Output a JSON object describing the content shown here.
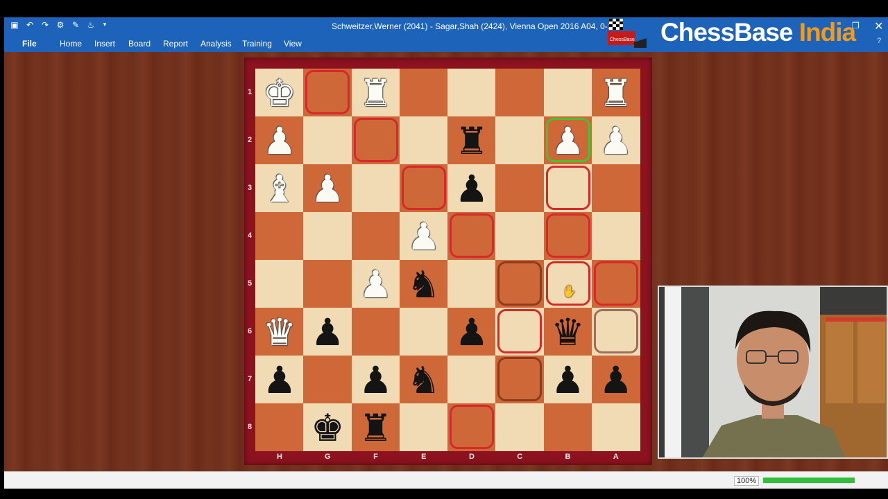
{
  "window": {
    "title": "Schweitzer,Werner (2041) - Sagar,Shah (2424), Vienna Open 2016  A04, 0-1",
    "close_glyph": "✕",
    "restore_glyph": "❐",
    "help_glyph": "?"
  },
  "quick_access": [
    "new-icon",
    "undo-icon",
    "redo-icon",
    "settings-icon",
    "tool-icon",
    "hint-icon",
    "dropdown-icon"
  ],
  "menu": {
    "file": "File",
    "items": [
      "Home",
      "Insert",
      "Board",
      "Report",
      "Analysis",
      "Training",
      "View"
    ]
  },
  "logo": {
    "small_text": "ChessBase",
    "brand_main": "ChessBase ",
    "brand_accent": "India"
  },
  "board": {
    "ranks": [
      "1",
      "2",
      "3",
      "4",
      "5",
      "6",
      "7",
      "8"
    ],
    "files": [
      "H",
      "G",
      "F",
      "E",
      "D",
      "C",
      "B",
      "A"
    ],
    "pieces": [
      [
        "♚",
        "",
        "♜",
        "",
        "",
        "",
        "",
        "♜"
      ],
      [
        "♟",
        "",
        "",
        "",
        "♜",
        "",
        "♟",
        "♟"
      ],
      [
        "♝",
        "♟",
        "",
        "",
        "♟",
        "",
        "",
        ""
      ],
      [
        "",
        "",
        "",
        "♟",
        "",
        "",
        "",
        ""
      ],
      [
        "",
        "",
        "♟",
        "♞",
        "",
        "",
        "",
        ""
      ],
      [
        "♛",
        "♟",
        "",
        "",
        "♟",
        "",
        "♛",
        ""
      ],
      [
        "♟",
        "",
        "♟",
        "♞",
        "",
        "",
        "♟",
        "♟"
      ],
      [
        "",
        "♚",
        "♜",
        "",
        "",
        "",
        "",
        ""
      ]
    ],
    "colors": [
      [
        "w",
        "",
        "w",
        "",
        "",
        "",
        "",
        "w"
      ],
      [
        "w",
        "",
        "",
        "",
        "b",
        "",
        "w",
        "w"
      ],
      [
        "w",
        "w",
        "",
        "",
        "b",
        "",
        "",
        ""
      ],
      [
        "",
        "",
        "",
        "w",
        "",
        "",
        "",
        ""
      ],
      [
        "",
        "",
        "w",
        "b",
        "",
        "",
        "",
        ""
      ],
      [
        "w",
        "b",
        "",
        "",
        "b",
        "",
        "b",
        ""
      ],
      [
        "b",
        "",
        "b",
        "b",
        "",
        "",
        "b",
        "b"
      ],
      [
        "",
        "b",
        "b",
        "",
        "",
        "",
        "",
        ""
      ]
    ],
    "highlights": [
      {
        "rank": 0,
        "file": 1,
        "color": "red"
      },
      {
        "rank": 1,
        "file": 2,
        "color": "red"
      },
      {
        "rank": 1,
        "file": 6,
        "color": "green"
      },
      {
        "rank": 2,
        "file": 3,
        "color": "red"
      },
      {
        "rank": 2,
        "file": 6,
        "color": "red"
      },
      {
        "rank": 3,
        "file": 4,
        "color": "red"
      },
      {
        "rank": 3,
        "file": 6,
        "color": "red"
      },
      {
        "rank": 4,
        "file": 5,
        "color": "brown"
      },
      {
        "rank": 4,
        "file": 6,
        "color": "red"
      },
      {
        "rank": 4,
        "file": 7,
        "color": "red"
      },
      {
        "rank": 5,
        "file": 5,
        "color": "red"
      },
      {
        "rank": 5,
        "file": 7,
        "color": "pale"
      },
      {
        "rank": 6,
        "file": 5,
        "color": "brown"
      },
      {
        "rank": 7,
        "file": 4,
        "color": "red"
      }
    ],
    "cursor_glyph": "✋"
  },
  "status": {
    "zoom": "100%",
    "progress": 1.0
  },
  "colors": {
    "ribbon": "#1d63b9",
    "light_square": "#f0dbb4",
    "dark_square": "#cf6838",
    "frame": "#8c1220",
    "highlight_red": "#d7282a",
    "highlight_green": "#47c12e",
    "progress": "#2fbf3a"
  }
}
